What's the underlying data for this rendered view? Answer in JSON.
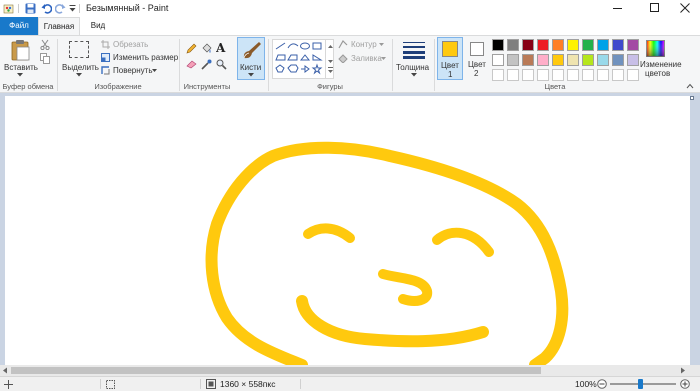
{
  "window": {
    "title": "Безымянный - Paint"
  },
  "tabs": {
    "file": "Файл",
    "home": "Главная",
    "view": "Вид"
  },
  "ribbon": {
    "clipboard": {
      "paste": "Вставить",
      "group": "Буфер обмена"
    },
    "image": {
      "select": "Выделить",
      "crop": "Обрезать",
      "resize": "Изменить размер",
      "rotate": "Повернуть",
      "group": "Изображение"
    },
    "tools": {
      "group": "Инструменты",
      "brushes": "Кисти"
    },
    "shapes": {
      "outline": "Контур",
      "fill": "Заливка",
      "group": "Фигуры"
    },
    "size": {
      "label": "Толщина"
    },
    "colors": {
      "color1_label": "Цвет\n1",
      "color1_l1": "Цвет",
      "color1_l2": "1",
      "color2_l1": "Цвет",
      "color2_l2": "2",
      "edit_l1": "Изменение",
      "edit_l2": "цветов",
      "group": "Цвета",
      "color1_value": "#ffc90e",
      "color2_value": "#ffffff",
      "palette_row1": [
        "#000000",
        "#7f7f7f",
        "#880015",
        "#ed1c24",
        "#ff7f27",
        "#fff200",
        "#22b14c",
        "#00a2e8",
        "#3f48cc",
        "#a349a4"
      ],
      "palette_row2": [
        "#ffffff",
        "#c3c3c3",
        "#b97a57",
        "#ffaec9",
        "#ffc90e",
        "#efe4b0",
        "#b5e61d",
        "#99d9ea",
        "#7092be",
        "#c8bfe7"
      ]
    }
  },
  "canvas": {
    "stroke_color": "#ffc90e"
  },
  "status": {
    "dimensions": "1360 × 558пкс",
    "zoom": "100%"
  }
}
